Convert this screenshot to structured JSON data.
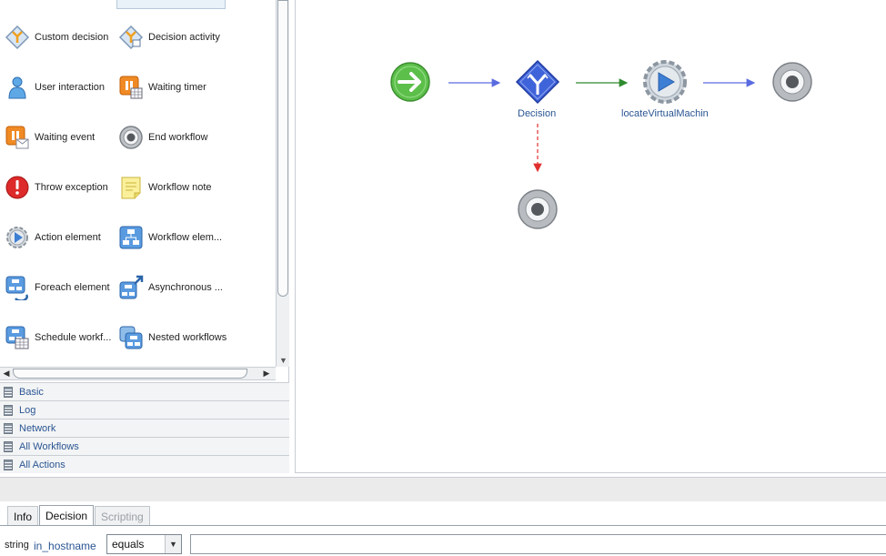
{
  "palette": {
    "items": [
      {
        "label": "Custom decision",
        "icon": "custom-decision-icon"
      },
      {
        "label": "Decision activity",
        "icon": "decision-activity-icon"
      },
      {
        "label": "User interaction",
        "icon": "user-interaction-icon"
      },
      {
        "label": "Waiting timer",
        "icon": "waiting-timer-icon"
      },
      {
        "label": "Waiting event",
        "icon": "waiting-event-icon"
      },
      {
        "label": "End workflow",
        "icon": "end-workflow-icon"
      },
      {
        "label": "Throw exception",
        "icon": "throw-exception-icon"
      },
      {
        "label": "Workflow note",
        "icon": "workflow-note-icon"
      },
      {
        "label": "Action element",
        "icon": "action-element-icon"
      },
      {
        "label": "Workflow elem...",
        "icon": "workflow-element-icon"
      },
      {
        "label": "Foreach element",
        "icon": "foreach-element-icon"
      },
      {
        "label": "Asynchronous ...",
        "icon": "asynchronous-workflow-icon"
      },
      {
        "label": "Schedule workf...",
        "icon": "schedule-workflow-icon"
      },
      {
        "label": "Nested workflows",
        "icon": "nested-workflows-icon"
      }
    ],
    "categories": [
      {
        "label": "Basic"
      },
      {
        "label": "Log"
      },
      {
        "label": "Network"
      },
      {
        "label": "All Workflows"
      },
      {
        "label": "All Actions"
      }
    ]
  },
  "canvas": {
    "nodes": [
      {
        "type": "start",
        "label": ""
      },
      {
        "type": "decision",
        "label": "Decision"
      },
      {
        "type": "action",
        "label": "locateVirtualMachin"
      },
      {
        "type": "end",
        "label": ""
      },
      {
        "type": "end",
        "label": ""
      }
    ],
    "colors": {
      "true_path": "#2e8b2e",
      "false_path": "#e03030",
      "normal_path": "#5a6ae0"
    }
  },
  "properties": {
    "tabs": [
      {
        "label": "Info",
        "state": "normal"
      },
      {
        "label": "Decision",
        "state": "active"
      },
      {
        "label": "Scripting",
        "state": "disabled"
      }
    ],
    "decision": {
      "type": "string",
      "parameter": "in_hostname",
      "operator": "equals",
      "value": ""
    }
  }
}
